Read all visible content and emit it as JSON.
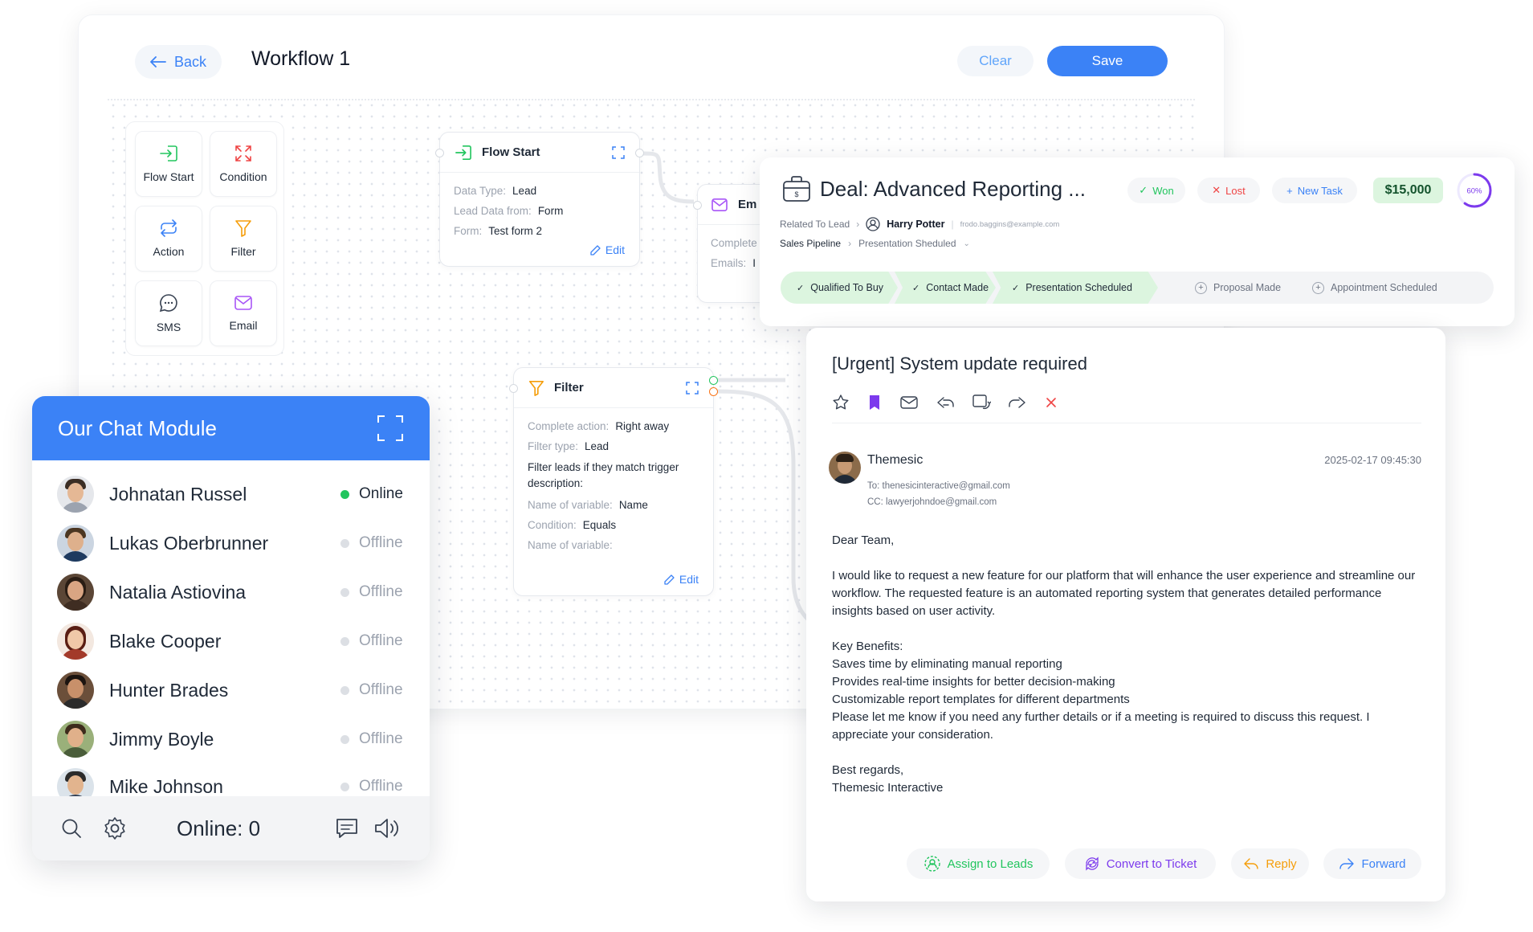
{
  "workflow": {
    "back_label": "Back",
    "title": "Workflow 1",
    "clear_label": "Clear",
    "save_label": "Save",
    "palette": [
      {
        "label": "Flow Start",
        "icon": "enter-icon",
        "color": "#22c55e"
      },
      {
        "label": "Condition",
        "icon": "expand-arrows-icon",
        "color": "#ef4444"
      },
      {
        "label": "Action",
        "icon": "refresh-icon",
        "color": "#3b82f6"
      },
      {
        "label": "Filter",
        "icon": "funnel-icon",
        "color": "#f59e0b"
      },
      {
        "label": "SMS",
        "icon": "chat-bubble-icon",
        "color": "#374151"
      },
      {
        "label": "Email",
        "icon": "envelope-icon",
        "color": "#a855f7"
      }
    ],
    "flow_start_node": {
      "title": "Flow Start",
      "rows": [
        {
          "label": "Data Type:",
          "value": "Lead"
        },
        {
          "label": "Lead Data from:",
          "value": "Form"
        },
        {
          "label": "Form:",
          "value": "Test form 2"
        }
      ],
      "edit_label": "Edit"
    },
    "email_node": {
      "title": "Em",
      "rows": [
        {
          "label": "Complete",
          "value": ""
        },
        {
          "label": "Emails:",
          "value": "I"
        }
      ]
    },
    "filter_node": {
      "title": "Filter",
      "rows": [
        {
          "label": "Complete action:",
          "value": "Right away"
        },
        {
          "label": "Filter type:",
          "value": "Lead"
        }
      ],
      "description": "Filter leads if they match trigger description:",
      "rows2": [
        {
          "label": "Name of variable:",
          "value": "Name"
        },
        {
          "label": "Condition:",
          "value": "Equals"
        },
        {
          "label": "Name of variable:",
          "value": ""
        }
      ],
      "edit_label": "Edit"
    }
  },
  "chat": {
    "title": "Our Chat Module",
    "contacts": [
      {
        "name": "Johnatan Russel",
        "status": "Online",
        "online": true
      },
      {
        "name": "Lukas Oberbrunner",
        "status": "Offline",
        "online": false
      },
      {
        "name": "Natalia Astiovina",
        "status": "Offline",
        "online": false
      },
      {
        "name": "Blake Cooper",
        "status": "Offline",
        "online": false
      },
      {
        "name": "Hunter Brades",
        "status": "Offline",
        "online": false
      },
      {
        "name": "Jimmy Boyle",
        "status": "Offline",
        "online": false
      },
      {
        "name": "Mike Johnson",
        "status": "Offline",
        "online": false
      }
    ],
    "online_count_label": "Online: 0",
    "accent": "#3b82f6"
  },
  "deal": {
    "title": "Deal: Advanced Reporting ...",
    "won_label": "Won",
    "lost_label": "Lost",
    "new_task_label": "New Task",
    "amount": "$15,000",
    "progress_label": "60%",
    "progress": 0.6,
    "related_label": "Related To Lead",
    "contact_name": "Harry Potter",
    "contact_email": "frodo.baggins@example.com",
    "pipeline_label": "Sales Pipeline",
    "pipeline_stage": "Presentation Sheduled",
    "stages": [
      {
        "label": "Qualified To Buy",
        "done": true
      },
      {
        "label": "Contact Made",
        "done": true
      },
      {
        "label": "Presentation Scheduled",
        "done": true
      },
      {
        "label": "Proposal Made",
        "done": false
      },
      {
        "label": "Appointment Scheduled",
        "done": false
      }
    ]
  },
  "email": {
    "subject": "[Urgent] System update required",
    "sender": "Themesic",
    "date": "2025-02-17 09:45:30",
    "to": "To: thenesicinteractive@gmail.com",
    "cc": "CC: lawyerjohndoe@gmail.com",
    "greeting": "Dear Team,",
    "paragraph": "I would like to request a new feature for our platform that will enhance the user experience and streamline our workflow. The requested feature is an automated reporting system that generates detailed performance insights based on user activity.",
    "benefits_title": "Key Benefits:",
    "benefits": [
      "Saves time by eliminating manual reporting",
      "Provides real-time insights for better decision-making",
      "Customizable report templates for different departments"
    ],
    "closing": "Please let me know if you need any further details or if a meeting is required to discuss this request. I appreciate your consideration.",
    "signoff": "Best regards,",
    "signature": "Themesic Interactive",
    "actions": {
      "assign": "Assign to Leads",
      "convert": "Convert to Ticket",
      "reply": "Reply",
      "forward": "Forward"
    }
  }
}
